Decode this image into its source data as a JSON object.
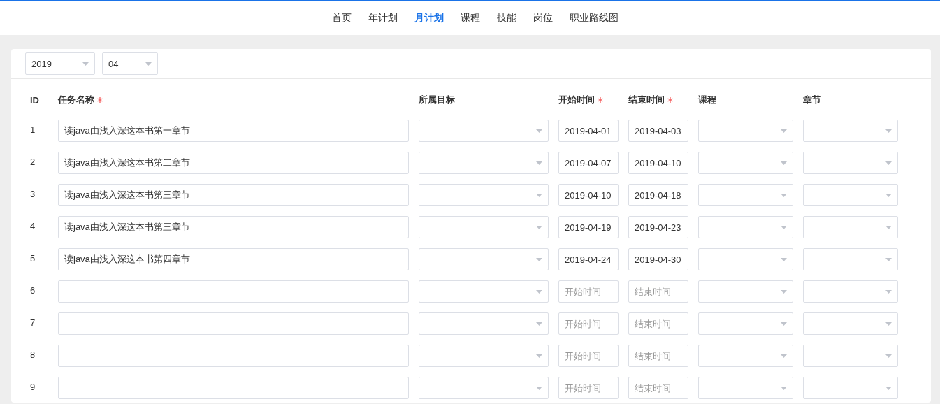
{
  "nav": [
    {
      "label": "首页",
      "selected": false
    },
    {
      "label": "年计划",
      "selected": false
    },
    {
      "label": "月计划",
      "selected": true
    },
    {
      "label": "课程",
      "selected": false
    },
    {
      "label": "技能",
      "selected": false
    },
    {
      "label": "岗位",
      "selected": false
    },
    {
      "label": "职业路线图",
      "selected": false
    }
  ],
  "filters": {
    "year": "2019",
    "month": "04"
  },
  "table": {
    "columns": [
      {
        "label": "ID",
        "required": false
      },
      {
        "label": "任务名称",
        "required": true
      },
      {
        "label": "所属目标",
        "required": false
      },
      {
        "label": "开始时间",
        "required": true
      },
      {
        "label": "结束时间",
        "required": true
      },
      {
        "label": "课程",
        "required": false
      },
      {
        "label": "章节",
        "required": false
      }
    ],
    "rows": [
      {
        "id": "1",
        "task": "读java由浅入深这本书第一章节",
        "start": {
          "value": "2019-04-01"
        },
        "end": {
          "value": "2019-04-03"
        }
      },
      {
        "id": "2",
        "task": "读java由浅入深这本书第二章节",
        "start": {
          "value": "2019-04-07"
        },
        "end": {
          "value": "2019-04-10"
        }
      },
      {
        "id": "3",
        "task": "读java由浅入深这本书第三章节",
        "start": {
          "value": "2019-04-10"
        },
        "end": {
          "value": "2019-04-18"
        }
      },
      {
        "id": "4",
        "task": "读java由浅入深这本书第三章节",
        "start": {
          "value": "2019-04-19"
        },
        "end": {
          "value": "2019-04-23"
        }
      },
      {
        "id": "5",
        "task": "读java由浅入深这本书第四章节",
        "start": {
          "value": "2019-04-24"
        },
        "end": {
          "value": "2019-04-30"
        }
      },
      {
        "id": "6",
        "start": {
          "placeholder": "开始时间"
        },
        "end": {
          "placeholder": "结束时间"
        }
      },
      {
        "id": "7",
        "start": {
          "placeholder": "开始时间"
        },
        "end": {
          "placeholder": "结束时间"
        }
      },
      {
        "id": "8",
        "start": {
          "placeholder": "开始时间"
        },
        "end": {
          "placeholder": "结束时间"
        }
      },
      {
        "id": "9",
        "start": {
          "placeholder": "开始时间"
        },
        "end": {
          "placeholder": "结束时间"
        }
      }
    ]
  }
}
